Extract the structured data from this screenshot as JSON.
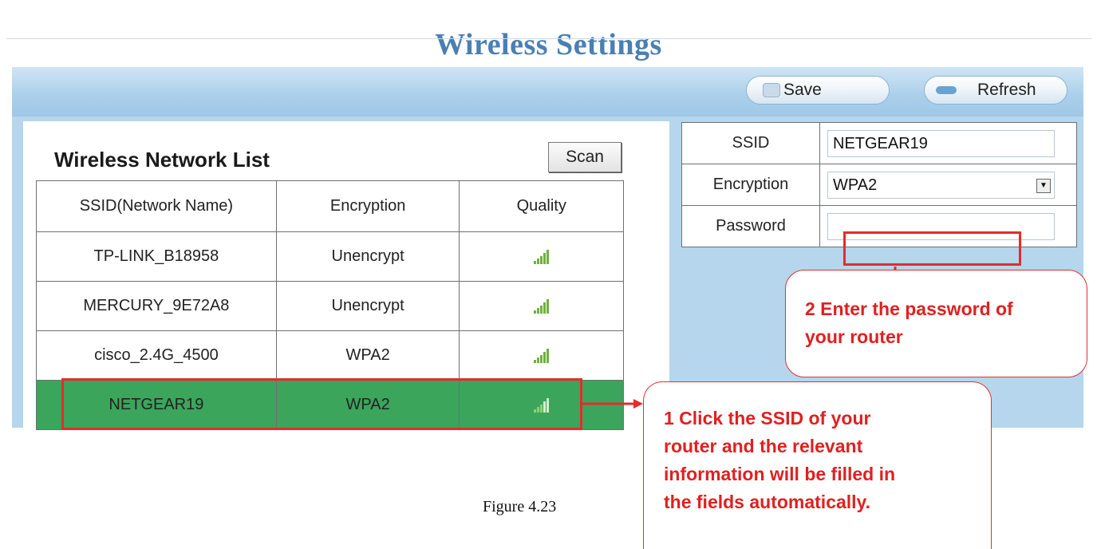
{
  "title": "Wireless Settings",
  "toolbar": {
    "save_label": "Save",
    "refresh_label": "Refresh"
  },
  "network_list": {
    "heading": "Wireless Network List",
    "scan_label": "Scan",
    "columns": [
      "SSID(Network Name)",
      "Encryption",
      "Quality"
    ],
    "rows": [
      {
        "ssid": "TP-LINK_B18958",
        "encryption": "Unencrypt",
        "quality_bars": 5,
        "selected": false
      },
      {
        "ssid": "MERCURY_9E72A8",
        "encryption": "Unencrypt",
        "quality_bars": 5,
        "selected": false
      },
      {
        "ssid": "cisco_2.4G_4500",
        "encryption": "WPA2",
        "quality_bars": 5,
        "selected": false
      },
      {
        "ssid": "NETGEAR19",
        "encryption": "WPA2",
        "quality_bars": 3,
        "selected": true
      }
    ]
  },
  "form": {
    "ssid_label": "SSID",
    "ssid_value": "NETGEAR19",
    "encryption_label": "Encryption",
    "encryption_value": "WPA2",
    "password_label": "Password",
    "password_value": ""
  },
  "annotations": {
    "password_lines": [
      "2 Enter the password of",
      "your router"
    ],
    "ssid_lines": [
      "1 Click the SSID of your",
      "router and the relevant",
      "information will be filled in",
      "the fields automatically."
    ]
  },
  "caption": "Figure 4.23",
  "colors": {
    "title": "#4a7fb3",
    "panel": "#b5d6ec",
    "selected_row": "#3ba55c",
    "annotation": "#e62b2b",
    "signal": "#6fb33b"
  },
  "icons": {
    "save": "floppy-icon",
    "refresh": "refresh-icon",
    "quality": "signal-strength-icon",
    "select": "chevron-down-icon"
  }
}
